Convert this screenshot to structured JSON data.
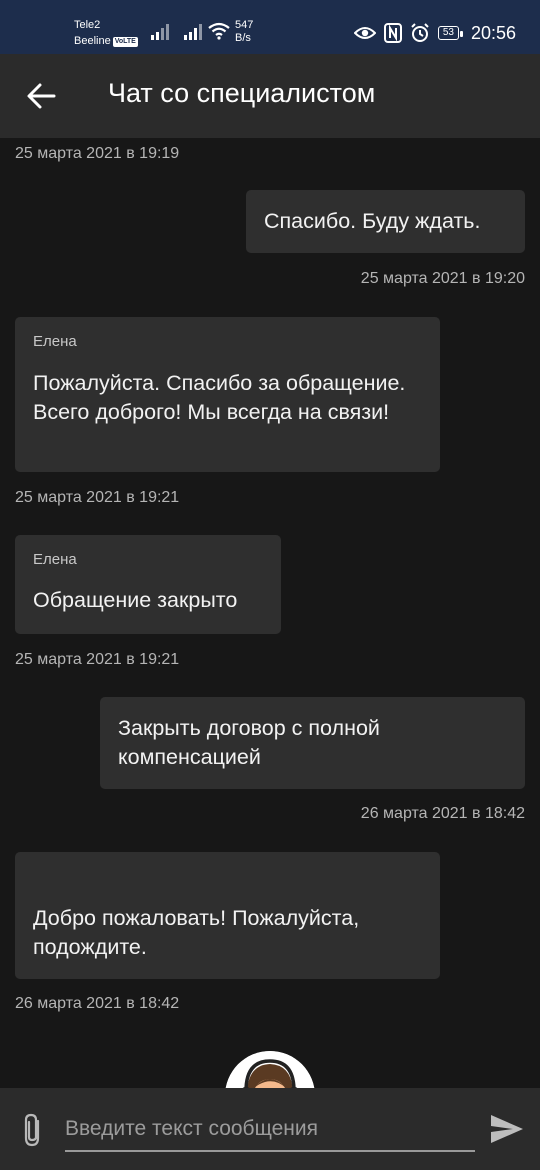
{
  "status_bar": {
    "carrier_1": "Tele2",
    "carrier_2": "Beeline",
    "volte_badge": "VoLTE",
    "speed_value": "547",
    "speed_unit": "B/s",
    "battery": "53",
    "time": "20:56",
    "icons": [
      "signal-icon",
      "wifi-icon",
      "eye-icon",
      "nfc-icon",
      "alarm-icon",
      "battery-icon"
    ]
  },
  "header": {
    "title": "Чат со специалистом"
  },
  "messages": [
    {
      "type": "timestamp",
      "text": "25 марта 2021 в 19:19"
    },
    {
      "type": "outgoing",
      "text": "Спасибо. Буду ждать."
    },
    {
      "type": "timestamp",
      "text": "25 марта 2021 в 19:20"
    },
    {
      "type": "incoming",
      "sender": "Елена",
      "text": "Пожалуйста. Спасибо за обращение. Всего доброго! Мы всегда на связи!"
    },
    {
      "type": "timestamp",
      "text": "25 марта 2021 в 19:21"
    },
    {
      "type": "incoming",
      "sender": "Елена",
      "text": "Обращение закрыто"
    },
    {
      "type": "timestamp",
      "text": "25 марта 2021 в 19:21"
    },
    {
      "type": "outgoing",
      "text": "Закрыть договор с полной компенсацией"
    },
    {
      "type": "timestamp",
      "text": "26 марта 2021 в 18:42"
    },
    {
      "type": "incoming",
      "sender": "",
      "text": "Добро пожаловать! Пожалуйста, подождите."
    },
    {
      "type": "timestamp",
      "text": "26 марта 2021 в 18:42"
    }
  ],
  "input": {
    "placeholder": "Введите текст сообщения",
    "value": ""
  },
  "colors": {
    "status_bar": "#1d2d4c",
    "app_bar": "#2b2b2b",
    "background": "#171717",
    "bubble": "#2f2f2f"
  }
}
